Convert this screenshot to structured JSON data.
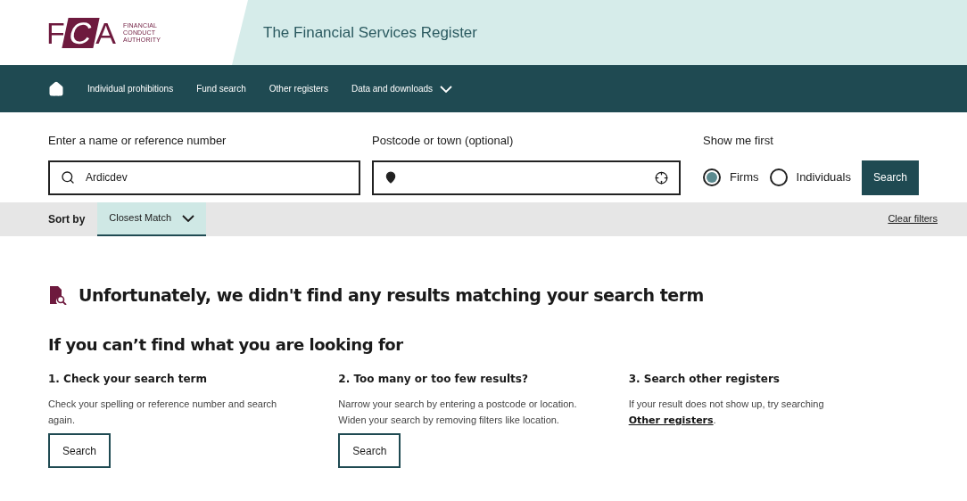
{
  "logo": {
    "mark": "FCA",
    "lines": [
      "FINANCIAL",
      "CONDUCT",
      "AUTHORITY"
    ]
  },
  "site_title": "The Financial Services Register",
  "nav": [
    {
      "label": "Individual prohibitions",
      "dropdown": false
    },
    {
      "label": "Fund search",
      "dropdown": false
    },
    {
      "label": "Other registers",
      "dropdown": false
    },
    {
      "label": "Data and downloads",
      "dropdown": true
    }
  ],
  "search": {
    "name_label": "Enter a name or reference number",
    "name_value": "Ardicdev",
    "location_label": "Postcode or town (optional)",
    "show_label": "Show me first",
    "options": [
      {
        "label": "Firms",
        "selected": true
      },
      {
        "label": "Individuals",
        "selected": false
      }
    ],
    "button": "Search"
  },
  "sort": {
    "label": "Sort by",
    "value": "Closest Match",
    "clear": "Clear filters"
  },
  "no_results": "Unfortunately, we didn't find any results matching your search term",
  "help_title": "If you can’t find what you are looking for",
  "help": [
    {
      "title": "1. Check your search term",
      "text": "Check your spelling or reference number and search again.",
      "button": "Search"
    },
    {
      "title": "2. Too many or too few results?",
      "text": "Narrow your search by entering a postcode or location. Widen your search by removing filters like location.",
      "button": "Search"
    },
    {
      "title": "3. Search other registers",
      "text": "If your result does not show up, try searching ",
      "link": "Other registers",
      "after": "."
    }
  ]
}
